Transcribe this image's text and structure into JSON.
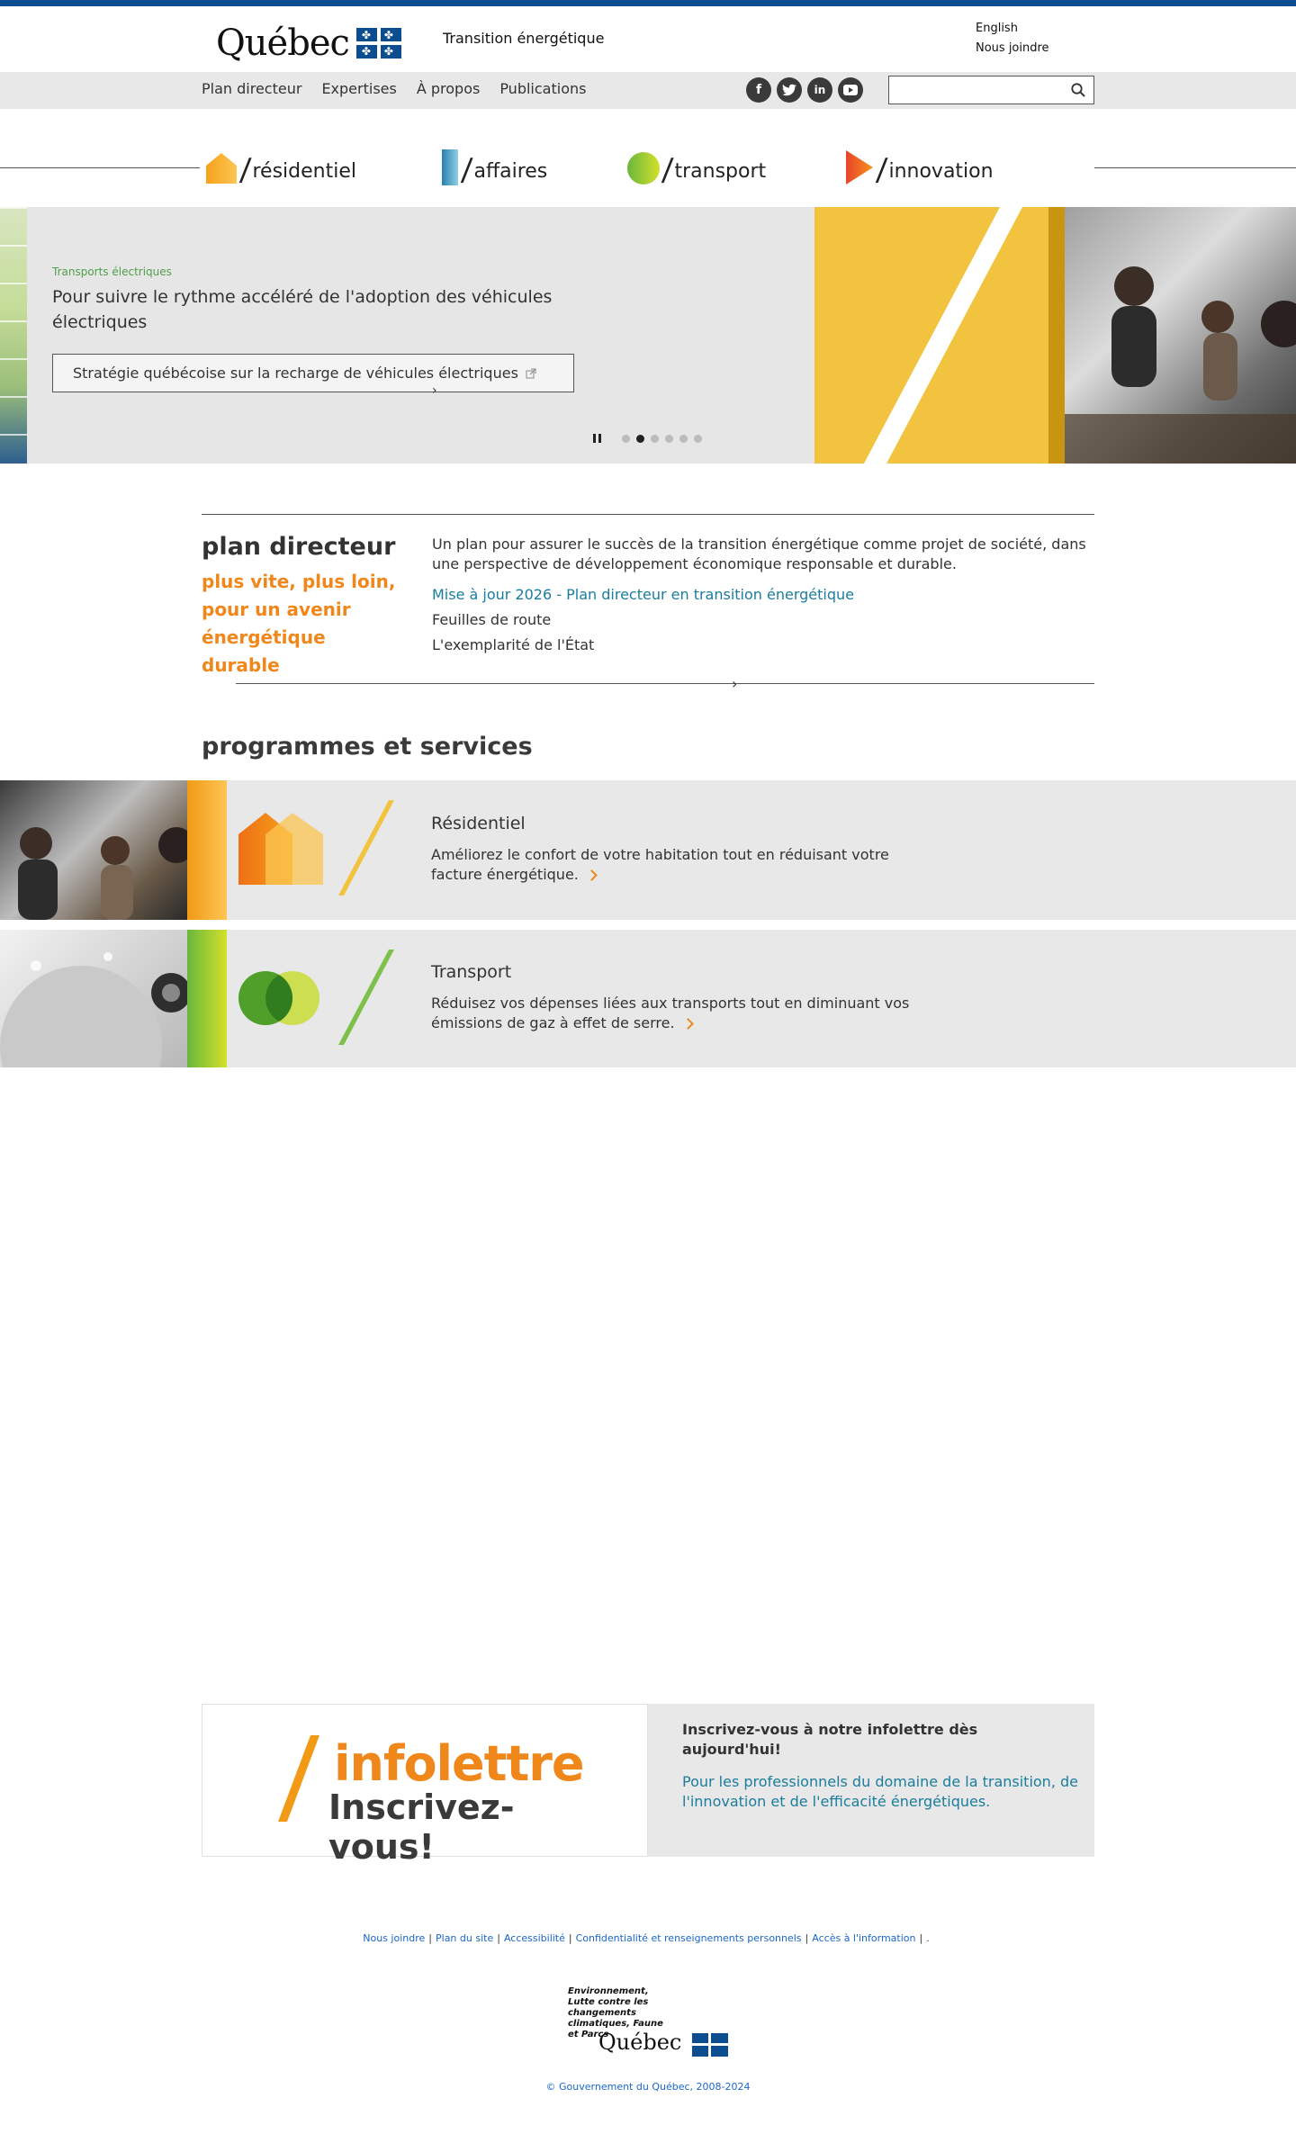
{
  "header": {
    "logo_word": "Québec",
    "site_title": "Transition énergétique",
    "lang_link": "English",
    "contact_link": "Nous joindre"
  },
  "nav": {
    "items": [
      "Plan directeur",
      "Expertises",
      "À propos",
      "Publications"
    ],
    "social": [
      "facebook-icon",
      "twitter-icon",
      "linkedin-icon",
      "youtube-icon"
    ],
    "search_placeholder": ""
  },
  "categories": [
    {
      "label": "résidentiel",
      "icon": "house-icon"
    },
    {
      "label": "affaires",
      "icon": "building-icon"
    },
    {
      "label": "transport",
      "icon": "circle-icon"
    },
    {
      "label": "innovation",
      "icon": "triangle-icon"
    }
  ],
  "hero": {
    "kicker": "Transports électriques",
    "title": "Pour suivre le rythme accéléré de l'adoption des véhicules électriques",
    "button": "Stratégie québécoise sur la recharge de véhicules électriques",
    "slide_count": 6,
    "active_slide": 2
  },
  "plan": {
    "title": "plan directeur",
    "tagline": "plus vite, plus loin, pour un avenir énergétique durable",
    "description": "Un plan pour assurer le succès de la transition énergétique comme projet de société, dans une perspective de développement économique responsable et durable.",
    "links": [
      "Mise à jour 2026 - Plan directeur en transition énergétique",
      "Feuilles de route",
      "L'exemplarité de l'État"
    ]
  },
  "programs": {
    "heading": "programmes et services",
    "items": [
      {
        "title": "Résidentiel",
        "description": "Améliorez le confort de votre habitation tout en réduisant votre facture énergétique."
      },
      {
        "title": "Transport",
        "description": "Réduisez vos dépenses liées aux transports tout en diminuant vos émissions de gaz à effet de serre."
      }
    ]
  },
  "newsletter": {
    "brand_word": "infolettre",
    "brand_cta": "Inscrivez-vous!",
    "headline": "Inscrivez-vous à notre infolettre dès aujourd'hui!",
    "description": "Pour les professionnels du domaine de la transition, de l'innovation et de l'efficacité énergétiques."
  },
  "footer": {
    "links": [
      "Nous joindre",
      "Plan du site",
      "Accessibilité",
      "Confidentialité et renseignements personnels",
      "Accès à l'information"
    ],
    "ministry": "Environnement, Lutte contre les changements climatiques, Faune et Parcs",
    "logo_word": "Québec",
    "copyright": "© Gouvernement du Québec, 2008-2024"
  },
  "colors": {
    "brand_blue": "#0b4d8f",
    "accent_orange": "#f0871a",
    "link_teal": "#1b7d9d",
    "transport_green": "#4fa04c",
    "hero_yellow": "#f1c33e"
  }
}
